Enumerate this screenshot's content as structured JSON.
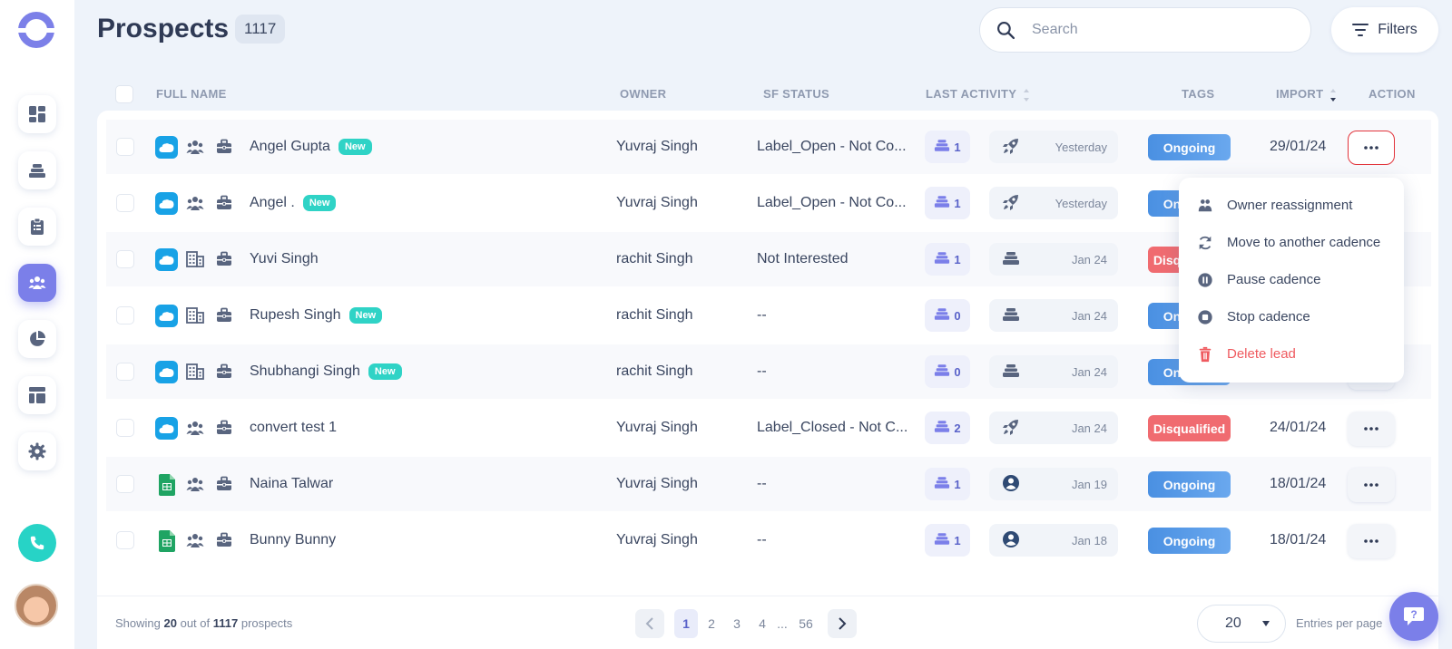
{
  "header": {
    "title": "Prospects",
    "count": "1117",
    "search_placeholder": "Search",
    "filters_label": "Filters"
  },
  "columns": {
    "full_name": "FULL NAME",
    "owner": "OWNER",
    "sf_status": "SF STATUS",
    "last_activity": "LAST ACTIVITY",
    "tags": "TAGS",
    "import": "IMPORT",
    "action": "ACTION"
  },
  "rows": [
    {
      "source": "salesforce-icon",
      "type": "contacts-icon",
      "name": "Angel Gupta",
      "new": "New",
      "owner": "Yuvraj Singh",
      "sf_status": "Label_Open - Not Co...",
      "cadences": "1",
      "last_icon": "rocket-icon",
      "last_date": "Yesterday",
      "tag": "Ongoing",
      "import": "29/01/24"
    },
    {
      "source": "salesforce-icon",
      "type": "contacts-icon",
      "name": "Angel .",
      "new": "New",
      "owner": "Yuvraj Singh",
      "sf_status": "Label_Open - Not Co...",
      "cadences": "1",
      "last_icon": "rocket-icon",
      "last_date": "Yesterday",
      "tag": "Ongoing",
      "import": ""
    },
    {
      "source": "salesforce-icon",
      "type": "building-icon",
      "name": "Yuvi Singh",
      "new": "",
      "owner": "rachit Singh",
      "sf_status": "Not Interested",
      "cadences": "1",
      "last_icon": "cadence-icon",
      "last_date": "Jan 24",
      "tag": "Disqualified",
      "import": ""
    },
    {
      "source": "salesforce-icon",
      "type": "building-icon",
      "name": "Rupesh Singh",
      "new": "New",
      "owner": "rachit Singh",
      "sf_status": "--",
      "cadences": "0",
      "last_icon": "cadence-icon",
      "last_date": "Jan 24",
      "tag": "Ongoing",
      "import": ""
    },
    {
      "source": "salesforce-icon",
      "type": "building-icon",
      "name": "Shubhangi Singh",
      "new": "New",
      "owner": "rachit Singh",
      "sf_status": "--",
      "cadences": "0",
      "last_icon": "cadence-icon",
      "last_date": "Jan 24",
      "tag": "Ongoing",
      "import": ""
    },
    {
      "source": "salesforce-icon",
      "type": "contacts-icon",
      "name": "convert test 1",
      "new": "",
      "owner": "Yuvraj Singh",
      "sf_status": "Label_Closed - Not C...",
      "cadences": "2",
      "last_icon": "rocket-icon",
      "last_date": "Jan 24",
      "tag": "Disqualified",
      "import": "24/01/24"
    },
    {
      "source": "google-sheets-icon",
      "type": "contacts-icon",
      "name": "Naina Talwar",
      "new": "",
      "owner": "Yuvraj Singh",
      "sf_status": "--",
      "cadences": "1",
      "last_icon": "user-icon",
      "last_date": "Jan 19",
      "tag": "Ongoing",
      "import": "18/01/24"
    },
    {
      "source": "google-sheets-icon",
      "type": "contacts-icon",
      "name": "Bunny Bunny",
      "new": "",
      "owner": "Yuvraj Singh",
      "sf_status": "--",
      "cadences": "1",
      "last_icon": "user-icon",
      "last_date": "Jan 18",
      "tag": "Ongoing",
      "import": "18/01/24"
    }
  ],
  "action_menu": {
    "items": [
      {
        "label": "Owner reassignment",
        "icon": "people-icon"
      },
      {
        "label": "Move to another cadence",
        "icon": "refresh-icon"
      },
      {
        "label": "Pause cadence",
        "icon": "pause-icon"
      },
      {
        "label": "Stop cadence",
        "icon": "stop-icon"
      },
      {
        "label": "Delete lead",
        "icon": "trash-icon"
      }
    ]
  },
  "footer": {
    "showing_prefix": "Showing",
    "showing_count": "20",
    "showing_mid": "out of",
    "showing_total": "1117",
    "showing_suffix": "prospects",
    "pages": [
      "1",
      "2",
      "3",
      "4"
    ],
    "ellipsis": "...",
    "last_page": "56",
    "current_page": "1",
    "per_page_value": "20",
    "per_page_label": "Entries per page"
  },
  "colors": {
    "accent": "#7b7fe9",
    "ongoing": "#4a90e2",
    "disqualified": "#f06b70",
    "new_badge": "#2fd3c6",
    "danger": "#ef5a5f"
  }
}
